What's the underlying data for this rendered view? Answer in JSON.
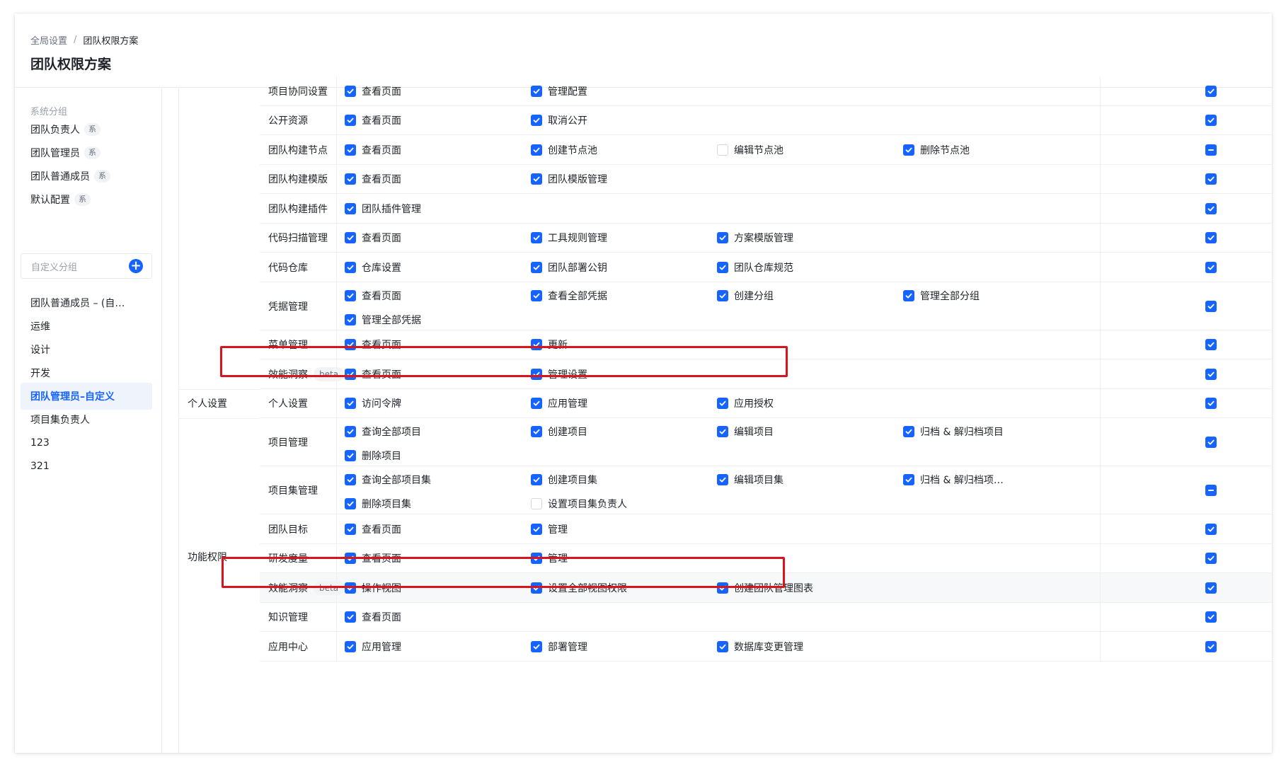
{
  "breadcrumb": {
    "root": "全局设置",
    "separator": "/",
    "current": "团队权限方案"
  },
  "page_title": "团队权限方案",
  "sidebar": {
    "system_group_label": "系统分组",
    "system_items": [
      {
        "label": "团队负责人",
        "tag": "系"
      },
      {
        "label": "团队管理员",
        "tag": "系"
      },
      {
        "label": "团队普通成员",
        "tag": "系"
      },
      {
        "label": "默认配置",
        "tag": "系"
      }
    ],
    "custom_group_label": "自定义分组",
    "custom_items": [
      {
        "label": "团队普通成员 – (自…"
      },
      {
        "label": "运维"
      },
      {
        "label": "设计"
      },
      {
        "label": "开发"
      },
      {
        "label": "团队管理员–自定义",
        "active": true
      },
      {
        "label": "项目集负责人"
      },
      {
        "label": "123"
      },
      {
        "label": "321"
      }
    ]
  },
  "categories": [
    {
      "label": "个人设置"
    },
    {
      "label": "功能权限"
    }
  ],
  "beta_label": "beta",
  "rows": [
    {
      "label": "项目协同设置",
      "perms": [
        [
          "查看页面",
          "on"
        ],
        [
          "管理配置",
          "on"
        ]
      ],
      "all": "on"
    },
    {
      "label": "公开资源",
      "perms": [
        [
          "查看页面",
          "on"
        ],
        [
          "取消公开",
          "on"
        ]
      ],
      "all": "on"
    },
    {
      "label": "团队构建节点",
      "perms": [
        [
          "查看页面",
          "on"
        ],
        [
          "创建节点池",
          "on"
        ],
        [
          "编辑节点池",
          "off"
        ],
        [
          "删除节点池",
          "on"
        ]
      ],
      "all": "ind"
    },
    {
      "label": "团队构建模版",
      "perms": [
        [
          "查看页面",
          "on"
        ],
        [
          "团队模版管理",
          "on"
        ]
      ],
      "all": "on"
    },
    {
      "label": "团队构建插件",
      "perms": [
        [
          "团队插件管理",
          "on"
        ]
      ],
      "all": "on"
    },
    {
      "label": "代码扫描管理",
      "perms": [
        [
          "查看页面",
          "on"
        ],
        [
          "工具规则管理",
          "on"
        ],
        [
          "方案模版管理",
          "on"
        ]
      ],
      "all": "on"
    },
    {
      "label": "代码仓库",
      "perms": [
        [
          "仓库设置",
          "on"
        ],
        [
          "团队部署公钥",
          "on"
        ],
        [
          "团队仓库规范",
          "on"
        ]
      ],
      "all": "on"
    },
    {
      "label": "凭据管理",
      "perms": [
        [
          "查看页面",
          "on"
        ],
        [
          "查看全部凭据",
          "on"
        ],
        [
          "创建分组",
          "on"
        ],
        [
          "管理全部分组",
          "on"
        ],
        [
          "管理全部凭据",
          "on"
        ]
      ],
      "all": "on"
    },
    {
      "label": "菜单管理",
      "perms": [
        [
          "查看页面",
          "on"
        ],
        [
          "更新",
          "on"
        ]
      ],
      "all": "on"
    },
    {
      "label": "效能洞察",
      "beta": true,
      "perms": [
        [
          "查看页面",
          "on"
        ],
        [
          "管理设置",
          "on"
        ]
      ],
      "all": "on"
    },
    {
      "label": "个人设置",
      "perms": [
        [
          "访问令牌",
          "on"
        ],
        [
          "应用管理",
          "on"
        ],
        [
          "应用授权",
          "on"
        ]
      ],
      "all": "on"
    },
    {
      "label": "项目管理",
      "perms": [
        [
          "查询全部项目",
          "on"
        ],
        [
          "创建项目",
          "on"
        ],
        [
          "编辑项目",
          "on"
        ],
        [
          "归档 & 解归档项目",
          "on"
        ],
        [
          "删除项目",
          "on"
        ]
      ],
      "all": "on"
    },
    {
      "label": "项目集管理",
      "perms": [
        [
          "查询全部项目集",
          "on"
        ],
        [
          "创建项目集",
          "on"
        ],
        [
          "编辑项目集",
          "on"
        ],
        [
          "归档 & 解归档项…",
          "on"
        ],
        [
          "删除项目集",
          "on"
        ],
        [
          "设置项目集负责人",
          "off"
        ]
      ],
      "all": "ind"
    },
    {
      "label": "团队目标",
      "perms": [
        [
          "查看页面",
          "on"
        ],
        [
          "管理",
          "on"
        ]
      ],
      "all": "on"
    },
    {
      "label": "研发度量",
      "perms": [
        [
          "查看页面",
          "on"
        ],
        [
          "管理",
          "on"
        ]
      ],
      "all": "on"
    },
    {
      "label": "效能洞察",
      "beta": true,
      "perms": [
        [
          "操作视图",
          "on"
        ],
        [
          "设置全部视图权限",
          "on"
        ],
        [
          "创建团队管理图表",
          "on"
        ]
      ],
      "all": "on"
    },
    {
      "label": "知识管理",
      "perms": [
        [
          "查看页面",
          "on"
        ]
      ],
      "all": "on"
    },
    {
      "label": "应用中心",
      "perms": [
        [
          "应用管理",
          "on"
        ],
        [
          "部署管理",
          "on"
        ],
        [
          "数据库变更管理",
          "on"
        ]
      ],
      "all": "on"
    }
  ],
  "colors": {
    "accent": "#1664ff",
    "highlight_box": "#d9141c"
  }
}
